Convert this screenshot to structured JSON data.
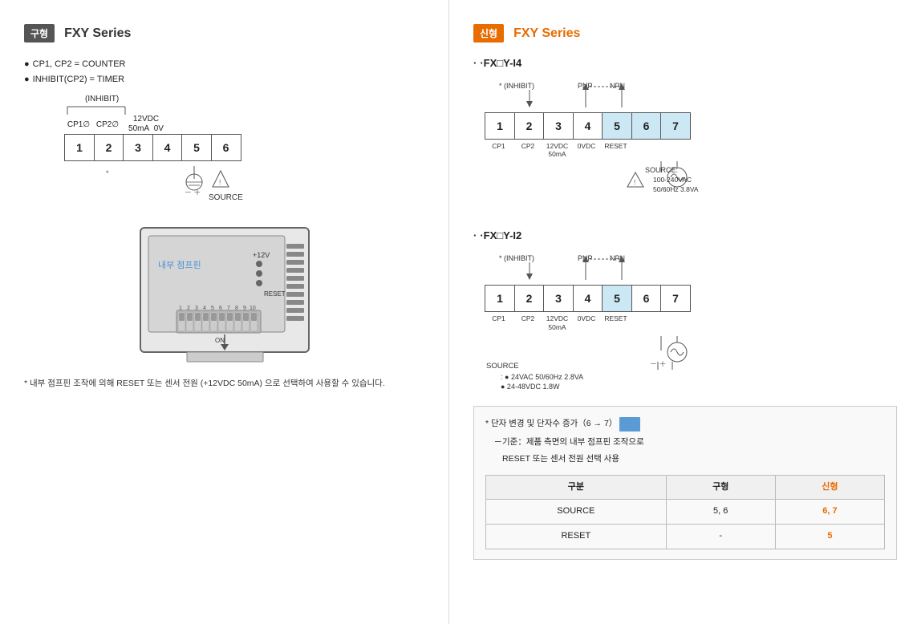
{
  "left": {
    "badge": "구형",
    "title": "FXY Series",
    "bullets": [
      "CP1, CP2 = COUNTER",
      "INHIBIT(CP2) = TIMER"
    ],
    "inhibit_label": "(INHIBIT)",
    "terminals": {
      "top_labels": [
        "CP1",
        "CP2",
        "12VDC",
        "50mA",
        "0V"
      ],
      "cells": [
        "1",
        "2",
        "3",
        "4",
        "5",
        "6"
      ],
      "source_label": "SOURCE"
    },
    "dip_label": "내부 점프핀",
    "dip_plus": "+12V",
    "dip_reset": "RESET",
    "dip_numbers": [
      "1",
      "2",
      "3",
      "4",
      "5",
      "6",
      "7",
      "8",
      "9",
      "10"
    ],
    "dip_on": "ON",
    "note": "* 내부 점프핀 조작에 의해 RESET\n  또는 센서 전원 (+12VDC 50mA)\n  으로 선택하여 사용할 수 있습니다."
  },
  "right": {
    "badge": "신형",
    "title": "FXY Series",
    "subsections": [
      {
        "id": "i4",
        "label": "·FX□Y-I4",
        "inhibit_label": "* (INHIBIT)",
        "pnp_label": "PNP",
        "npn_label": "NPN",
        "cells": [
          "1",
          "2",
          "3",
          "4",
          "5",
          "6",
          "7"
        ],
        "blue_cells": [
          4,
          5,
          6
        ],
        "labels": [
          "CP1",
          "CP2",
          "12VDC\n50mA",
          "0VDC",
          "RESET",
          "",
          ""
        ],
        "source_title": "SOURCE:",
        "source_lines": [
          "100-240VAC",
          "50/60Hz 3.8VA"
        ]
      },
      {
        "id": "i2",
        "label": "·FX□Y-I2",
        "inhibit_label": "* (INHIBIT)",
        "pnp_label": "PNP",
        "npn_label": "NPN",
        "cells": [
          "1",
          "2",
          "3",
          "4",
          "5",
          "6",
          "7"
        ],
        "blue_cells": [
          4
        ],
        "labels": [
          "CP1",
          "CP2",
          "12VDC\n50mA",
          "0VDC",
          "RESET",
          "",
          ""
        ],
        "source_title": "SOURCE",
        "source_lines": [
          ": ● 24VAC 50/60Hz 2.8VA",
          "  ● 24-48VDC 1.8W"
        ]
      }
    ],
    "note_box": {
      "line1_prefix": "* 단자 변경 및 단자수 증가（6 → 7）",
      "line1_highlight": "",
      "line2": "－기준：제품 측면의 내부 점프핀 조작으로",
      "line3": "   RESET 또는 센서 전원 선택 사용",
      "table": {
        "headers": [
          "구분",
          "구형",
          "신형"
        ],
        "rows": [
          [
            "SOURCE",
            "5, 6",
            "6, 7"
          ],
          [
            "RESET",
            "-",
            "5"
          ]
        ]
      }
    }
  }
}
